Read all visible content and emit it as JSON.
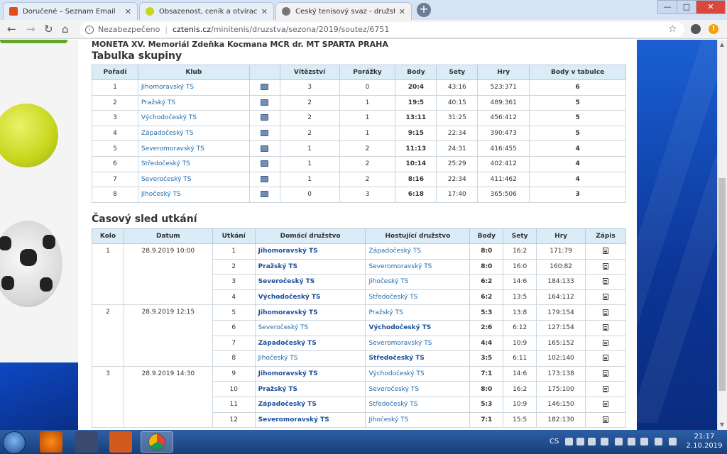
{
  "browser": {
    "tabs": [
      {
        "title": "Doručené – Seznam Email",
        "close": "✕"
      },
      {
        "title": "Obsazenost, ceník a otvírací dob",
        "close": "✕"
      },
      {
        "title": "Český tenisový svaz - družstva",
        "close": "✕"
      }
    ],
    "new_tab": "+",
    "security_label": "Nezabezpečeno",
    "url_host": "cztenis.cz",
    "url_path": "/minitenis/druzstva/sezona/2019/soutez/6751",
    "icons": [
      "back-icon",
      "forward-icon",
      "reload-icon",
      "home-icon",
      "info-icon",
      "star-icon",
      "account-icon",
      "update-icon"
    ]
  },
  "page": {
    "competition": "MONETA XV. Memoriál Zdeňka Kocmana MCR dr. MT SPARTA PRAHA",
    "standings_title": "Tabulka skupiny",
    "standings_headers": [
      "Pořadí",
      "Klub",
      "",
      "Vítězství",
      "Porážky",
      "Body",
      "Sety",
      "Hry",
      "Body v tabulce"
    ],
    "standings": [
      {
        "rank": "1",
        "club": "Jihomoravský TS",
        "wins": "3",
        "losses": "0",
        "points": "20:4",
        "sets": "43:16",
        "games": "523:371",
        "table_points": "6"
      },
      {
        "rank": "2",
        "club": "Pražský TS",
        "wins": "2",
        "losses": "1",
        "points": "19:5",
        "sets": "40:15",
        "games": "489:361",
        "table_points": "5"
      },
      {
        "rank": "3",
        "club": "Východočeský TS",
        "wins": "2",
        "losses": "1",
        "points": "13:11",
        "sets": "31:25",
        "games": "456:412",
        "table_points": "5"
      },
      {
        "rank": "4",
        "club": "Západočeský TS",
        "wins": "2",
        "losses": "1",
        "points": "9:15",
        "sets": "22:34",
        "games": "390:473",
        "table_points": "5"
      },
      {
        "rank": "5",
        "club": "Severomoravský TS",
        "wins": "1",
        "losses": "2",
        "points": "11:13",
        "sets": "24:31",
        "games": "416:455",
        "table_points": "4"
      },
      {
        "rank": "6",
        "club": "Středočeský TS",
        "wins": "1",
        "losses": "2",
        "points": "10:14",
        "sets": "25:29",
        "games": "402:412",
        "table_points": "4"
      },
      {
        "rank": "7",
        "club": "Severočeský TS",
        "wins": "1",
        "losses": "2",
        "points": "8:16",
        "sets": "22:34",
        "games": "411:462",
        "table_points": "4"
      },
      {
        "rank": "8",
        "club": "Jihočeský TS",
        "wins": "0",
        "losses": "3",
        "points": "6:18",
        "sets": "17:40",
        "games": "365:506",
        "table_points": "3"
      }
    ],
    "schedule_title": "Časový sled utkání",
    "schedule_headers": [
      "Kolo",
      "Datum",
      "Utkání",
      "Domácí družstvo",
      "Hostující družstvo",
      "Body",
      "Sety",
      "Hry",
      "Zápis"
    ],
    "rounds": [
      {
        "round": "1",
        "date": "28.9.2019 10:00",
        "matches": [
          {
            "no": "1",
            "home": "Jihomoravský TS",
            "away": "Západočeský TS",
            "winner": "home",
            "points": "8:0",
            "sets": "16:2",
            "games": "171:79"
          },
          {
            "no": "2",
            "home": "Pražský TS",
            "away": "Severomoravský TS",
            "winner": "home",
            "points": "8:0",
            "sets": "16:0",
            "games": "160:82"
          },
          {
            "no": "3",
            "home": "Severočeský TS",
            "away": "Jihočeský TS",
            "winner": "home",
            "points": "6:2",
            "sets": "14:6",
            "games": "184:133"
          },
          {
            "no": "4",
            "home": "Východočeský TS",
            "away": "Středočeský TS",
            "winner": "home",
            "points": "6:2",
            "sets": "13:5",
            "games": "164:112"
          }
        ]
      },
      {
        "round": "2",
        "date": "28.9.2019 12:15",
        "matches": [
          {
            "no": "5",
            "home": "Jihomoravský TS",
            "away": "Pražský TS",
            "winner": "home",
            "points": "5:3",
            "sets": "13:8",
            "games": "179:154"
          },
          {
            "no": "6",
            "home": "Severočeský TS",
            "away": "Východočeský TS",
            "winner": "away",
            "points": "2:6",
            "sets": "6:12",
            "games": "127:154"
          },
          {
            "no": "7",
            "home": "Západočeský TS",
            "away": "Severomoravský TS",
            "winner": "home",
            "points": "4:4",
            "sets": "10:9",
            "games": "165:152"
          },
          {
            "no": "8",
            "home": "Jihočeský TS",
            "away": "Středočeský TS",
            "winner": "away",
            "points": "3:5",
            "sets": "6:11",
            "games": "102:140"
          }
        ]
      },
      {
        "round": "3",
        "date": "28.9.2019 14:30",
        "matches": [
          {
            "no": "9",
            "home": "Jihomoravský TS",
            "away": "Východočeský TS",
            "winner": "home",
            "points": "7:1",
            "sets": "14:6",
            "games": "173:138"
          },
          {
            "no": "10",
            "home": "Pražský TS",
            "away": "Severočeský TS",
            "winner": "home",
            "points": "8:0",
            "sets": "16:2",
            "games": "175:100"
          },
          {
            "no": "11",
            "home": "Západočeský TS",
            "away": "Středočeský TS",
            "winner": "home",
            "points": "5:3",
            "sets": "10:9",
            "games": "146:150"
          },
          {
            "no": "12",
            "home": "Severomoravský TS",
            "away": "Jihočeský TS",
            "winner": "home",
            "points": "7:1",
            "sets": "15:5",
            "games": "182:130"
          }
        ]
      }
    ]
  },
  "taskbar": {
    "language": "CS",
    "time": "21:17",
    "date": "2.10.2019"
  }
}
